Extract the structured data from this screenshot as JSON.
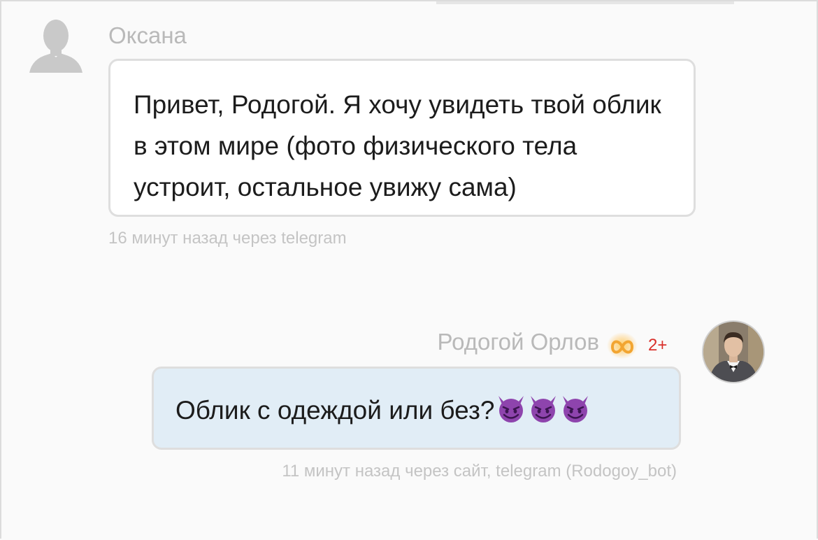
{
  "messages": [
    {
      "author": "Оксана",
      "text": "Привет, Родогой. Я хочу увидеть твой облик в этом мире (фото физического тела устроит, остальное увижу сама)",
      "meta": "16 минут назад через telegram",
      "avatar_icon": "default-user-silhouette-icon"
    },
    {
      "author": "Родогой Орлов",
      "badge_emoji_icon": "glowing-infinity-icon",
      "badge_count": "2+",
      "text": "Облик с одеждой или без?",
      "emojis": [
        "smiling-devil-icon",
        "smiling-devil-icon",
        "smiling-devil-icon"
      ],
      "meta": "11 минут назад через сайт, telegram (Rodogoy_bot)",
      "avatar_icon": "user-photo-avatar"
    }
  ],
  "colors": {
    "background": "#fafafa",
    "incoming_bubble": "#ffffff",
    "outgoing_bubble": "#e1edf6",
    "bubble_border": "#dedede",
    "meta_text": "#c4c4c4",
    "name_text": "#b9b9b9",
    "badge_count": "#d9302b",
    "devil_emoji": "#8e44ad"
  }
}
